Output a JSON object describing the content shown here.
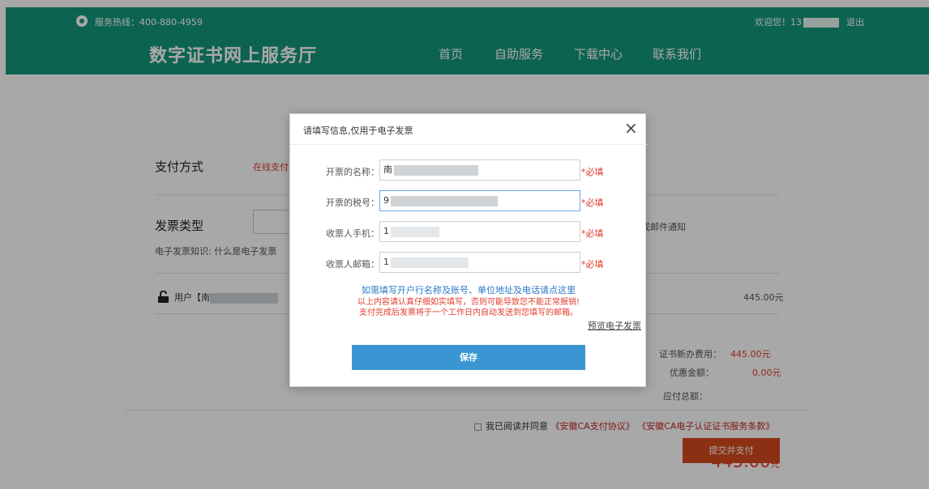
{
  "header": {
    "hotline_label": "服务热线：400-880-4959",
    "welcome": "欢迎您！13",
    "logout": "退出",
    "logo": "数字证书网上服务厅",
    "nav": [
      "首页",
      "自助服务",
      "下载中心",
      "联系我们"
    ]
  },
  "page": {
    "payment_label": "支付方式",
    "payment_online": "在线支付",
    "invoice_label": "发票类型",
    "invoice_knowledge": "电子发票知识: 什么是电子发票",
    "email_notice": "或邮件通知",
    "user_label": "用户【南",
    "user_amount": "445.00元",
    "new_fee_label": "证书新办费用：",
    "new_fee_value": "445.00元",
    "discount_label": "优惠金额：",
    "discount_value": "0.00元",
    "total_label": "应付总额：",
    "total_value": "445.00",
    "total_unit": "元",
    "agree_text": "我已阅读并同意",
    "agree_link1": "《安徽CA支付协议》",
    "agree_link2": "《安徽CA电子认证证书服务条款》",
    "submit": "提交并支付"
  },
  "dialog": {
    "title": "请填写信息,仅用于电子发票",
    "close": "×",
    "fields": [
      {
        "label": "开票的名称：",
        "value": "南",
        "required": "*必填"
      },
      {
        "label": "开票的税号：",
        "value": "9",
        "required": "*必填"
      },
      {
        "label": "收票人手机：",
        "value": "1",
        "required": "*必填"
      },
      {
        "label": "收票人邮箱：",
        "value": "1",
        "required": "*必填"
      }
    ],
    "note_blue": "如需填写开户行名称及账号、单位地址及电话请点这里",
    "note_red_1": "以上内容请认真仔细如实填写，否则可能导致您不能正常报销!",
    "note_red_2": "支付完成后发票将于一个工作日内自动发送到您填写的邮箱。",
    "preview": "预览电子发票",
    "save": "保存"
  },
  "colors": {
    "header_bg": "#14977b",
    "accent_red": "#e23b2d",
    "save_blue": "#3a96d2",
    "submit_orange": "#d54a1f"
  }
}
